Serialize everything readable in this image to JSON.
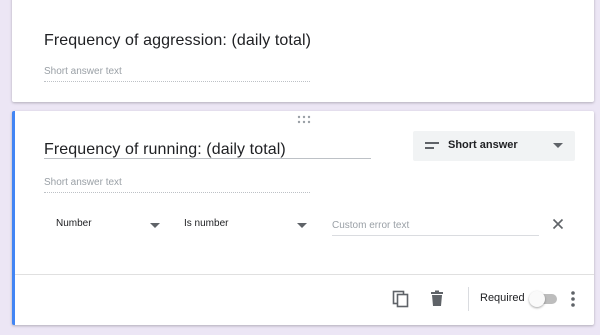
{
  "questions": [
    {
      "title": "Frequency of aggression: (daily total)",
      "answer_placeholder": "Short answer text"
    },
    {
      "title": "Frequency of running: (daily total)",
      "answer_placeholder": "Short answer text",
      "type_label": "Short answer",
      "validation": {
        "category": "Number",
        "condition": "Is number",
        "error_placeholder": "Custom error text"
      },
      "footer": {
        "required_label": "Required",
        "required_on": false
      }
    }
  ],
  "colors": {
    "accent": "#4285f4",
    "page_background": "#ece6f5",
    "icon_gray": "#5f6368"
  },
  "icons": [
    "drag-handle-icon",
    "short-answer-icon",
    "chevron-down-icon",
    "close-icon",
    "duplicate-icon",
    "delete-icon",
    "more-vert-icon"
  ]
}
